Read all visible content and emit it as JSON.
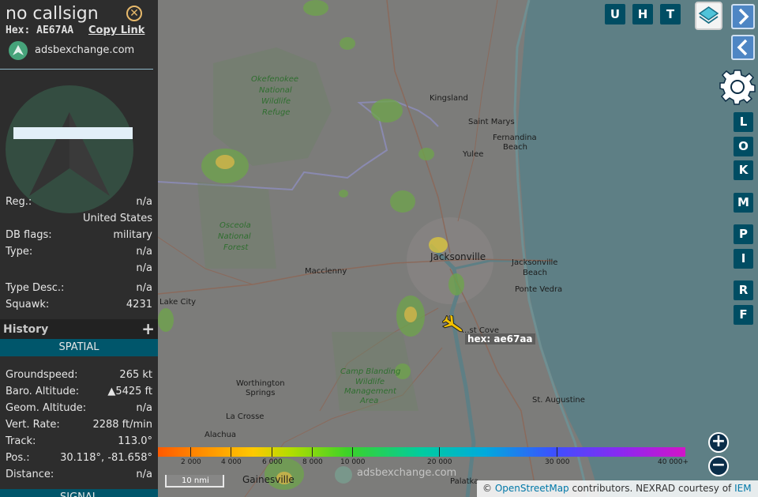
{
  "sidebar": {
    "callsign": "no callsign",
    "hex_label": "Hex: AE67AA",
    "copy_link": "Copy Link",
    "site_link": "adsbexchange.com",
    "rows_top": [
      {
        "key": "Reg.:",
        "value": "n/a"
      },
      {
        "key": "",
        "value": "United States"
      },
      {
        "key": "DB flags:",
        "value": "military"
      },
      {
        "key": "Type:",
        "value": "n/a"
      },
      {
        "key": "",
        "value": "n/a"
      },
      {
        "key": "Type Desc.:",
        "value": "n/a"
      },
      {
        "key": "Squawk:",
        "value": "4231"
      }
    ],
    "history_label": "History",
    "history_plus": "+",
    "spatial_label": "SPATIAL",
    "rows_spatial": [
      {
        "key": "Groundspeed:",
        "value": "265 kt"
      },
      {
        "key": "Baro. Altitude:",
        "value": "▲5425 ft"
      },
      {
        "key": "Geom. Altitude:",
        "value": "n/a"
      },
      {
        "key": "Vert. Rate:",
        "value": "2288 ft/min"
      },
      {
        "key": "Track:",
        "value": "113.0°"
      },
      {
        "key": "Pos.:",
        "value": "30.118°, -81.658°"
      },
      {
        "key": "Distance:",
        "value": "n/a"
      }
    ],
    "signal_label": "SIGNAL"
  },
  "map": {
    "top_buttons": [
      "U",
      "H",
      "T"
    ],
    "right_buttons": [
      "L",
      "O",
      "K",
      "M",
      "P",
      "I",
      "R",
      "F"
    ],
    "plane_label": "hex: ae67aa",
    "place_labels": {
      "kingsland": "Kingsland",
      "saint_marys": "Saint Marys",
      "fernandina": "Fernandina",
      "fernandina2": "Beach",
      "yulee": "Yulee",
      "jacksonville": "Jacksonville",
      "jax_beach": "Jacksonville",
      "jax_beach2": "Beach",
      "macclenny": "Macclenny",
      "ponte_vedra": "Ponte Vedra",
      "lake_city": "Lake City",
      "fleming_cove": "...st Cove",
      "worthington": "Worthington",
      "worthington2": "Springs",
      "la_crosse": "La Crosse",
      "alachua": "Alachua",
      "st_augustine": "St. Augustine",
      "palatka": "Palatka",
      "gainesville": "Gainesville",
      "okefenokee": "Okefenokee",
      "okefenokee2": "National",
      "okefenokee3": "Wildlife",
      "okefenokee4": "Refuge",
      "osceola": "Osceola",
      "osceola2": "National",
      "osceola3": "Forest",
      "camp_blanding": "Camp Blanding",
      "camp_blanding2": "Wildlife",
      "camp_blanding3": "Management",
      "camp_blanding4": "Area"
    },
    "altitude_labels": [
      "2 000",
      "4 000",
      "6 000",
      "8 000",
      "10 000",
      "20 000",
      "30 000",
      "40 000+"
    ],
    "scale_label": "10 nmi",
    "watermark": "adsbexchange.com",
    "attribution_prefix": "© ",
    "attribution_osm": "OpenStreetMap",
    "attribution_mid": " contributors. NEXRAD courtesy of ",
    "attribution_iem": "IEM",
    "zoom_in": "+",
    "zoom_out": "−"
  }
}
